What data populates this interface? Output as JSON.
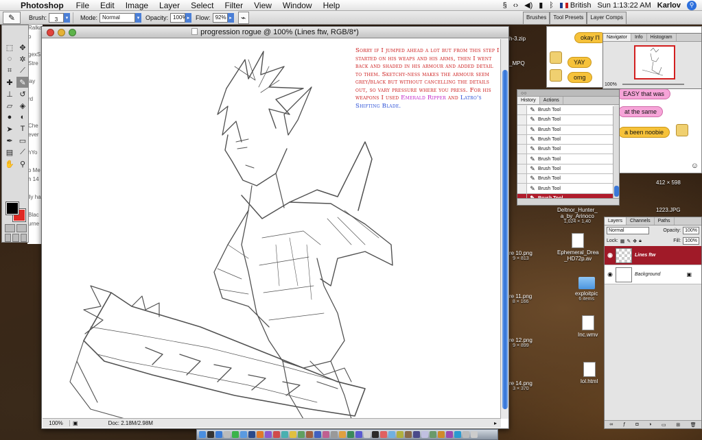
{
  "menubar": {
    "app_name": "Photoshop",
    "items": [
      "File",
      "Edit",
      "Image",
      "Layer",
      "Select",
      "Filter",
      "View",
      "Window",
      "Help"
    ],
    "keyboard": "British",
    "clock": "Sun 1:13:22 AM",
    "user": "Karlov"
  },
  "options_bar": {
    "brush_label": "Brush:",
    "brush_size": "3",
    "mode_label": "Mode:",
    "mode_value": "Normal",
    "opacity_label": "Opacity:",
    "opacity_value": "100%",
    "flow_label": "Flow:",
    "flow_value": "92%",
    "palette_tabs": [
      "Brushes",
      "Tool Presets",
      "Layer Comps"
    ]
  },
  "document": {
    "title": "progression rogue @ 100% (Lines ftw, RGB/8*)",
    "zoom": "100%",
    "doc_info": "Doc: 2.18M/2.98M",
    "notes": {
      "intro": "Sorry if I jumped ahead a lot but from this step I started on his weaps and his arms, then I went back and shaded in his armour and added detail to them. Sketchy-ness makes the armour seem grey/black but without cancelling the details out, so vary pressure where you press. For his weapons I used",
      "weapon1": "Emerald Ripper",
      "and": "and",
      "weapon2": "Latro's Shifting Blade."
    }
  },
  "behind_window_text": [
    "Ralkassi Karhe",
    "o",
    "",
    "gexS",
    "Stre",
    "",
    "lay",
    "",
    "rd",
    "",
    "",
    "Che",
    "ever",
    "",
    "hYo",
    "",
    "o Me",
    "h 14",
    "",
    "lly ha",
    "",
    "Blac",
    "urne"
  ],
  "navigator": {
    "tabs": [
      "Navigator",
      "Info",
      "Histogram"
    ],
    "zoom": "100%"
  },
  "chat": {
    "bubble1": "okay I'l",
    "bubble2": "YAY",
    "bubble3": "omg",
    "bubble4": "EASY that was",
    "bubble5": "at the same",
    "bubble6": "a been noobie",
    "file1": "h-3.zip",
    "file2": "_MPQ"
  },
  "history": {
    "tabs": [
      "History",
      "Actions"
    ],
    "rows": [
      "Brush Tool",
      "Brush Tool",
      "Brush Tool",
      "Brush Tool",
      "Brush Tool",
      "Brush Tool",
      "Brush Tool",
      "Brush Tool",
      "Brush Tool"
    ],
    "selected": "Brush Tool"
  },
  "layers": {
    "tabs": [
      "Layers",
      "Channels",
      "Paths"
    ],
    "blend_mode": "Normal",
    "opacity_label": "Opacity:",
    "opacity": "100%",
    "lock_label": "Lock:",
    "fill_label": "Fill:",
    "fill": "100%",
    "items": [
      {
        "name": "Lines ftw",
        "selected": true
      },
      {
        "name": "Background",
        "selected": false
      }
    ]
  },
  "desktop_icons": [
    {
      "name": "412 × 598",
      "sub": ""
    },
    {
      "name": "1223.JPG",
      "sub": ""
    },
    {
      "name": "Deltnor_Hunter_",
      "sub": "a_by_Arinoco",
      "sub2": "1,024 × 1,40"
    },
    {
      "name": "re 10.png",
      "sub": "9 × 813"
    },
    {
      "name": "Ephemeral_Drea",
      "sub": "_HD72p.av"
    },
    {
      "name": "re 11.png",
      "sub": "8 × 166"
    },
    {
      "name": "exploitpic",
      "sub": "6 items"
    },
    {
      "name": "re 12.png",
      "sub": "9 × 899"
    },
    {
      "name": "Inc.wmv",
      "sub": ""
    },
    {
      "name": "re 14.png",
      "sub": "3 × 370"
    },
    {
      "name": "lol.html",
      "sub": ""
    }
  ],
  "colors": {
    "notes_red": "#cc1a1a",
    "emerald_magenta": "#c022c8",
    "latro_blue": "#2a4fd6",
    "selection_red": "#a01a28",
    "foreground": "#000000",
    "background": "#e02a24"
  }
}
